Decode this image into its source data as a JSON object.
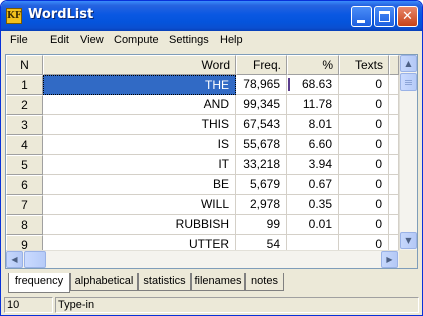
{
  "window": {
    "title": "WordList",
    "app_icon": "KF"
  },
  "title_buttons": {
    "minimize_icon": "minimize-icon",
    "maximize_icon": "maximize-icon",
    "close_icon": "close-icon"
  },
  "menu": [
    "File",
    "Edit",
    "View",
    "Compute",
    "Settings",
    "Help"
  ],
  "table": {
    "columns": [
      "N",
      "Word",
      "Freq.",
      "%",
      "Texts"
    ],
    "rows": [
      {
        "n": "1",
        "word": "THE",
        "freq": "78,965",
        "pct": "68.63",
        "texts": "0"
      },
      {
        "n": "2",
        "word": "AND",
        "freq": "99,345",
        "pct": "11.78",
        "texts": "0"
      },
      {
        "n": "3",
        "word": "THIS",
        "freq": "67,543",
        "pct": "8.01",
        "texts": "0"
      },
      {
        "n": "4",
        "word": "IS",
        "freq": "55,678",
        "pct": "6.60",
        "texts": "0"
      },
      {
        "n": "5",
        "word": "IT",
        "freq": "33,218",
        "pct": "3.94",
        "texts": "0"
      },
      {
        "n": "6",
        "word": "BE",
        "freq": "5,679",
        "pct": "0.67",
        "texts": "0"
      },
      {
        "n": "7",
        "word": "WILL",
        "freq": "2,978",
        "pct": "0.35",
        "texts": "0"
      },
      {
        "n": "8",
        "word": "RUBBISH",
        "freq": "99",
        "pct": "0.01",
        "texts": "0"
      },
      {
        "n": "9",
        "word": "UTTER",
        "freq": "54",
        "pct": "",
        "texts": "0"
      }
    ],
    "selected_row": 1
  },
  "tabs": [
    "frequency",
    "alphabetical",
    "statistics",
    "filenames",
    "notes"
  ],
  "active_tab": "frequency",
  "status": {
    "count": "10",
    "mode": "Type-in"
  },
  "colors": {
    "title_bar": "#0a58e2",
    "selection": "#316ac5",
    "face": "#ece9d8"
  }
}
